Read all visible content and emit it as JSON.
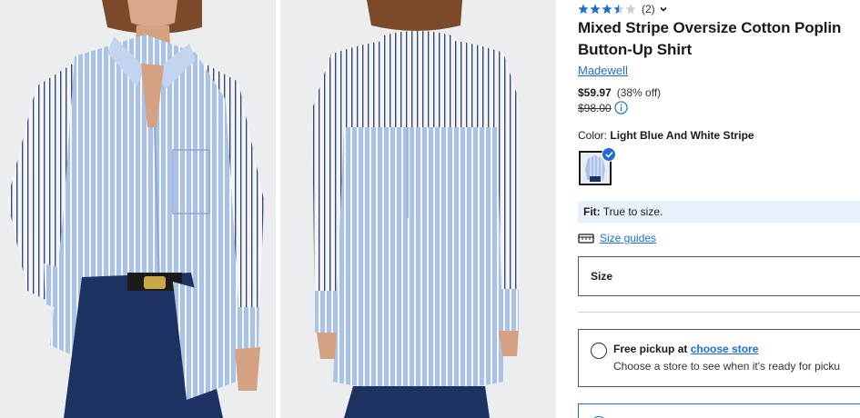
{
  "product": {
    "rating": {
      "value": 3.5,
      "max": 5,
      "count_label": "(2)"
    },
    "title": "Mixed Stripe Oversize Cotton Poplin Button-Up Shirt",
    "brand": "Madewell",
    "price": {
      "sale": "$59.97",
      "discount": "(38% off)",
      "original": "$98.00"
    },
    "color": {
      "label": "Color:",
      "value": "Light Blue And White Stripe"
    },
    "fit": {
      "label": "Fit:",
      "value": "True to size."
    },
    "size_guide_label": "Size guides",
    "size_label": "Size",
    "pickup": {
      "label": "Free pickup at",
      "action": "choose store",
      "description": "Choose a store to see when it's ready for picku"
    }
  },
  "gallery": {
    "images": [
      {
        "name": "front-view"
      },
      {
        "name": "back-view"
      }
    ]
  },
  "colors": {
    "accent": "#1f6fd1",
    "star": "#1f6fd1",
    "fit_bg": "#e8f1fb",
    "shirt_blue": "#a9c2e6",
    "photo_bg": "#ecedef",
    "jeans": "#1d3260"
  }
}
